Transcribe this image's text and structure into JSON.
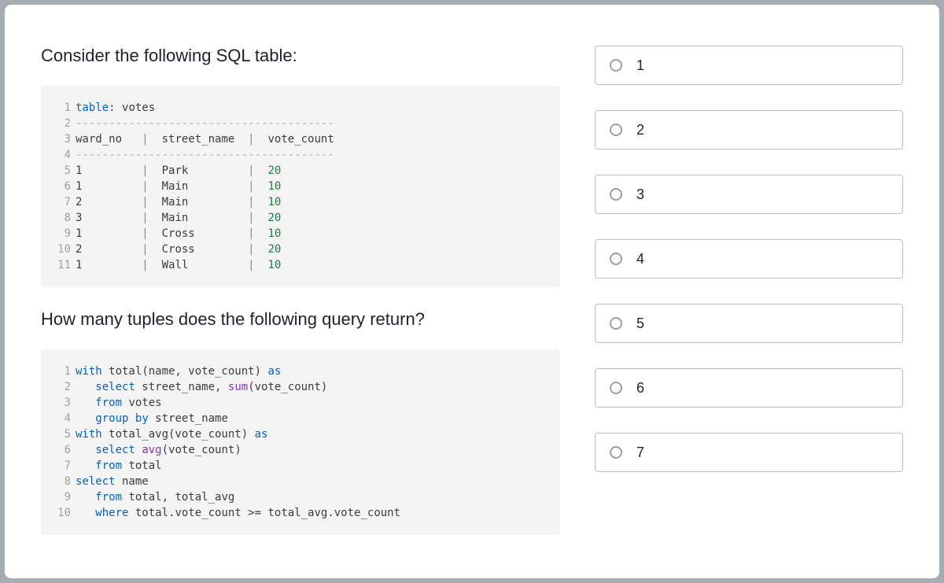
{
  "question": {
    "prompt1": "Consider the following SQL table:",
    "prompt2": "How many tuples does the following query return?"
  },
  "code1": [
    {
      "n": "1",
      "t": [
        [
          "kw",
          "table"
        ],
        [
          "",
          ": votes"
        ]
      ]
    },
    {
      "n": "2",
      "t": [
        [
          "dash",
          "---------------------------------------"
        ]
      ]
    },
    {
      "n": "3",
      "t": [
        [
          "",
          "ward_no   "
        ],
        [
          "pipe",
          "|"
        ],
        [
          "",
          "  street_name  "
        ],
        [
          "pipe",
          "|"
        ],
        [
          "",
          "  vote_count"
        ]
      ]
    },
    {
      "n": "4",
      "t": [
        [
          "dash",
          "---------------------------------------"
        ]
      ]
    },
    {
      "n": "5",
      "t": [
        [
          "",
          "1         "
        ],
        [
          "pipe",
          "|"
        ],
        [
          "",
          "  Park         "
        ],
        [
          "pipe",
          "|"
        ],
        [
          "",
          "  "
        ],
        [
          "num",
          "20"
        ]
      ]
    },
    {
      "n": "6",
      "t": [
        [
          "",
          "1         "
        ],
        [
          "pipe",
          "|"
        ],
        [
          "",
          "  Main         "
        ],
        [
          "pipe",
          "|"
        ],
        [
          "",
          "  "
        ],
        [
          "num",
          "10"
        ]
      ]
    },
    {
      "n": "7",
      "t": [
        [
          "",
          "2         "
        ],
        [
          "pipe",
          "|"
        ],
        [
          "",
          "  Main         "
        ],
        [
          "pipe",
          "|"
        ],
        [
          "",
          "  "
        ],
        [
          "num",
          "10"
        ]
      ]
    },
    {
      "n": "8",
      "t": [
        [
          "",
          "3         "
        ],
        [
          "pipe",
          "|"
        ],
        [
          "",
          "  Main         "
        ],
        [
          "pipe",
          "|"
        ],
        [
          "",
          "  "
        ],
        [
          "num",
          "20"
        ]
      ]
    },
    {
      "n": "9",
      "t": [
        [
          "",
          "1         "
        ],
        [
          "pipe",
          "|"
        ],
        [
          "",
          "  Cross        "
        ],
        [
          "pipe",
          "|"
        ],
        [
          "",
          "  "
        ],
        [
          "num",
          "10"
        ]
      ]
    },
    {
      "n": "10",
      "t": [
        [
          "",
          "2         "
        ],
        [
          "pipe",
          "|"
        ],
        [
          "",
          "  Cross        "
        ],
        [
          "pipe",
          "|"
        ],
        [
          "",
          "  "
        ],
        [
          "num",
          "20"
        ]
      ]
    },
    {
      "n": "11",
      "t": [
        [
          "",
          "1         "
        ],
        [
          "pipe",
          "|"
        ],
        [
          "",
          "  Wall         "
        ],
        [
          "pipe",
          "|"
        ],
        [
          "",
          "  "
        ],
        [
          "num",
          "10"
        ]
      ]
    }
  ],
  "code2": [
    {
      "n": "1",
      "t": [
        [
          "kw",
          "with"
        ],
        [
          "",
          " total(name, vote_count) "
        ],
        [
          "kw",
          "as"
        ]
      ]
    },
    {
      "n": "2",
      "t": [
        [
          "",
          "   "
        ],
        [
          "kw",
          "select"
        ],
        [
          "",
          " street_name, "
        ],
        [
          "func",
          "sum"
        ],
        [
          "",
          "(vote_count)"
        ]
      ]
    },
    {
      "n": "3",
      "t": [
        [
          "",
          "   "
        ],
        [
          "kw",
          "from"
        ],
        [
          "",
          " votes"
        ]
      ]
    },
    {
      "n": "4",
      "t": [
        [
          "",
          "   "
        ],
        [
          "kw",
          "group"
        ],
        [
          "",
          " "
        ],
        [
          "kw",
          "by"
        ],
        [
          "",
          " street_name"
        ]
      ]
    },
    {
      "n": "5",
      "t": [
        [
          "kw",
          "with"
        ],
        [
          "",
          " total_avg(vote_count) "
        ],
        [
          "kw",
          "as"
        ]
      ]
    },
    {
      "n": "6",
      "t": [
        [
          "",
          "   "
        ],
        [
          "kw",
          "select"
        ],
        [
          "",
          " "
        ],
        [
          "func",
          "avg"
        ],
        [
          "",
          "(vote_count)"
        ]
      ]
    },
    {
      "n": "7",
      "t": [
        [
          "",
          "   "
        ],
        [
          "kw",
          "from"
        ],
        [
          "",
          " total"
        ]
      ]
    },
    {
      "n": "8",
      "t": [
        [
          "kw",
          "select"
        ],
        [
          "",
          " name"
        ]
      ]
    },
    {
      "n": "9",
      "t": [
        [
          "",
          "   "
        ],
        [
          "kw",
          "from"
        ],
        [
          "",
          " total, total_avg"
        ]
      ]
    },
    {
      "n": "10",
      "t": [
        [
          "",
          "   "
        ],
        [
          "kw",
          "where"
        ],
        [
          "",
          " total.vote_count >= total_avg.vote_count"
        ]
      ]
    }
  ],
  "options": [
    {
      "label": "1"
    },
    {
      "label": "2"
    },
    {
      "label": "3"
    },
    {
      "label": "4"
    },
    {
      "label": "5"
    },
    {
      "label": "6"
    },
    {
      "label": "7"
    }
  ]
}
